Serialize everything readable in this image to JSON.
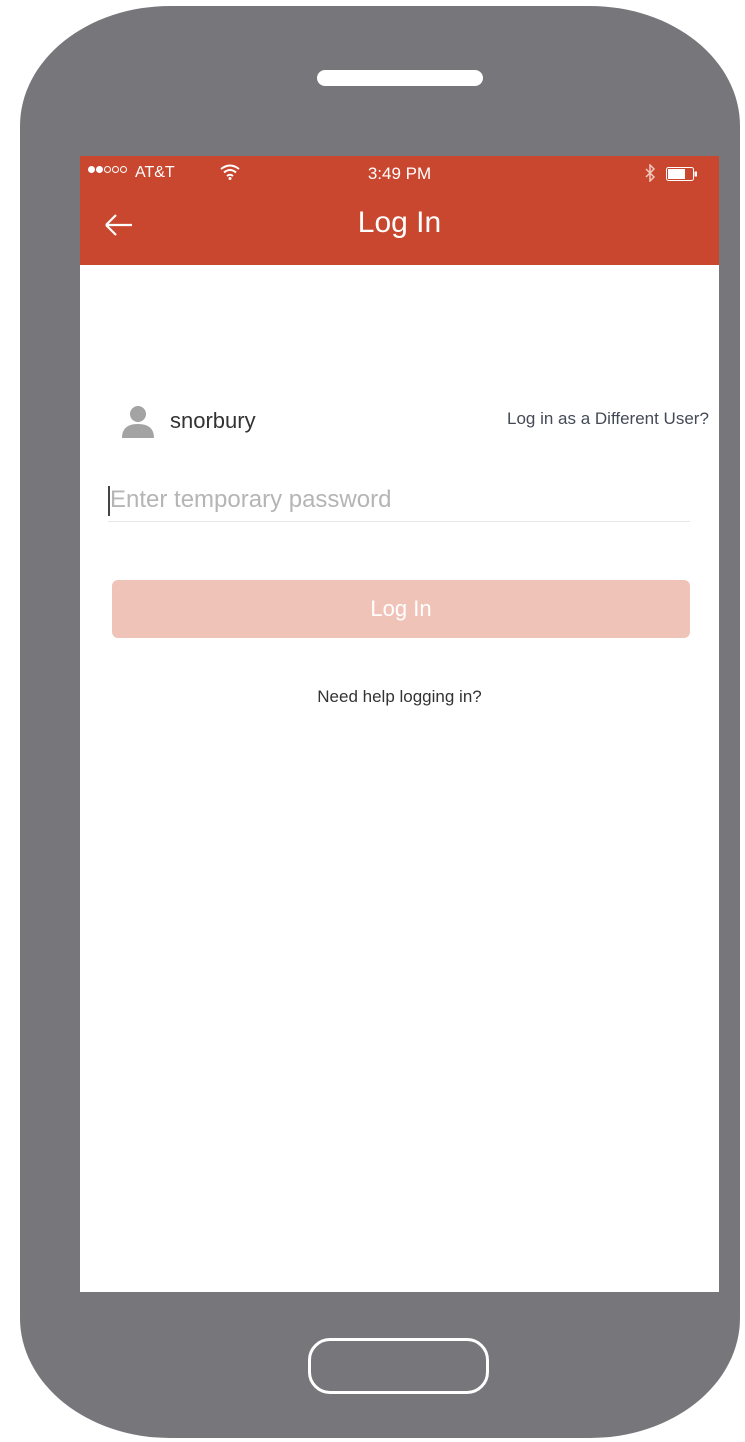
{
  "status_bar": {
    "carrier": "AT&T",
    "time": "3:49 PM",
    "signal_icon": "signal-dots-icon",
    "wifi_icon": "wifi-icon",
    "bluetooth_icon": "bluetooth-icon",
    "battery_icon": "battery-icon"
  },
  "nav": {
    "title": "Log In",
    "back_icon": "back-arrow-icon"
  },
  "user": {
    "icon": "user-icon",
    "username": "snorbury",
    "different_user_link": "Log in as a Different User?"
  },
  "password": {
    "value": "",
    "placeholder": "Enter temporary password"
  },
  "login_button": {
    "label": "Log In"
  },
  "help_link": {
    "label": "Need help logging in?"
  },
  "colors": {
    "header": "#c9472e",
    "button_disabled": "#f0c3b8",
    "device_body": "#77767b"
  }
}
